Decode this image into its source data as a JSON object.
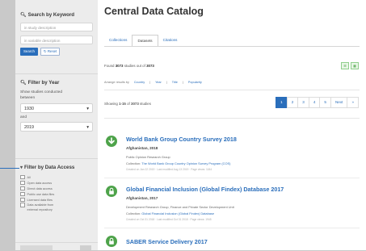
{
  "sidebar": {
    "keyword": {
      "title": "Search by Keyword",
      "input1_placeholder": "in study description",
      "input2_placeholder": "in variable description",
      "search_label": "Search",
      "reset_label": "Reset"
    },
    "year": {
      "title": "Filter by Year",
      "description": "Show studies conducted between",
      "from_value": "1930",
      "and_label": "and",
      "to_value": "2019"
    },
    "access": {
      "title": "Filter by Data Access",
      "options": [
        "All",
        "Open data access",
        "Direct data access",
        "Public use data files",
        "Licensed data files",
        "Data available from external repository"
      ]
    }
  },
  "main": {
    "title": "Central Data Catalog",
    "tabs": [
      {
        "label": "Collections"
      },
      {
        "label": "Datasets"
      },
      {
        "label": "Citations"
      }
    ],
    "found": {
      "prefix": "Found",
      "count": "3073",
      "middle": "studies out of",
      "total": "3073"
    },
    "sort": {
      "label": "Arrange results by",
      "options": [
        "Country",
        "Year",
        "Title",
        "Popularity"
      ]
    },
    "showing": {
      "prefix": "Showing",
      "range": "1-15",
      "of": "of",
      "total": "3073",
      "suffix": "studies"
    },
    "pager": [
      "1",
      "2",
      "3",
      "4",
      "5",
      "Next",
      "»"
    ],
    "results": [
      {
        "title": "World Bank Group Country Survey 2018",
        "author": "Afghanistan, 2018",
        "producer": "Public Opinion Research Group",
        "collection_prefix": "Collection:",
        "collection": "The World Bank Group Country Opinion Survey Program (COS)",
        "meta": "Created on Jan 22 2019 · Last modified Aug 13 2019 · Page views: 1184",
        "icon": "download-icon"
      },
      {
        "title": "Global Financial Inclusion (Global Findex) Database 2017",
        "author": "Afghanistan, 2017",
        "producer": "Development Research Group, Finance and Private Sector Development Unit",
        "collection_prefix": "Collection:",
        "collection": "Global Financial Inclusion (Global Findex) Database",
        "meta": "Created on Oct 31 2018 · Last modified Oct 31 2018 · Page views: 1945",
        "icon": "lock-icon"
      },
      {
        "title": "SABER Service Delivery 2017",
        "icon": "lock-icon"
      }
    ]
  }
}
